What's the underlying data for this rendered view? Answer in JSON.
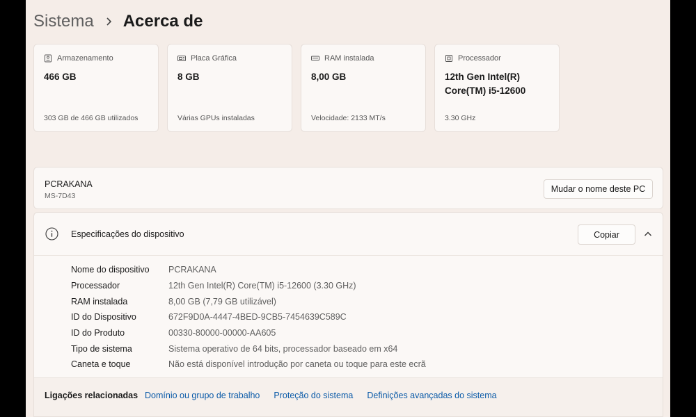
{
  "breadcrumb": {
    "parent": "Sistema",
    "current": "Acerca de"
  },
  "cards": [
    {
      "icon": "storage-icon",
      "label": "Armazenamento",
      "value": "466 GB",
      "sub": "303 GB de 466 GB utilizados"
    },
    {
      "icon": "graphics-card-icon",
      "label": "Placa Gráfica",
      "value": "8 GB",
      "sub": "Várias GPUs instaladas"
    },
    {
      "icon": "ram-icon",
      "label": "RAM instalada",
      "value": "8,00 GB",
      "sub": "Velocidade: 2133 MT/s"
    },
    {
      "icon": "processor-icon",
      "label": "Processador",
      "value": "12th Gen Intel(R) Core(TM) i5-12600",
      "sub": "3.30 GHz"
    }
  ],
  "pc": {
    "name": "PCRAKANA",
    "model": "MS-7D43",
    "rename_label": "Mudar o nome deste PC"
  },
  "specs": {
    "title": "Especificações do dispositivo",
    "copy_label": "Copiar",
    "rows": [
      {
        "label": "Nome do dispositivo",
        "value": "PCRAKANA"
      },
      {
        "label": "Processador",
        "value": "12th Gen Intel(R) Core(TM) i5-12600 (3.30 GHz)"
      },
      {
        "label": "RAM instalada",
        "value": "8,00 GB (7,79 GB utilizável)"
      },
      {
        "label": "ID do Dispositivo",
        "value": "672F9D0A-4447-4BED-9CB5-7454639C589C"
      },
      {
        "label": "ID do Produto",
        "value": "00330-80000-00000-AA605"
      },
      {
        "label": "Tipo de sistema",
        "value": "Sistema operativo de 64 bits, processador baseado em x64"
      },
      {
        "label": "Caneta e toque",
        "value": "Não está disponível introdução por caneta ou toque para este ecrã"
      }
    ]
  },
  "links": {
    "title": "Ligações relacionadas",
    "items": [
      "Domínio ou grupo de trabalho",
      "Proteção do sistema",
      "Definições avançadas do sistema"
    ]
  }
}
